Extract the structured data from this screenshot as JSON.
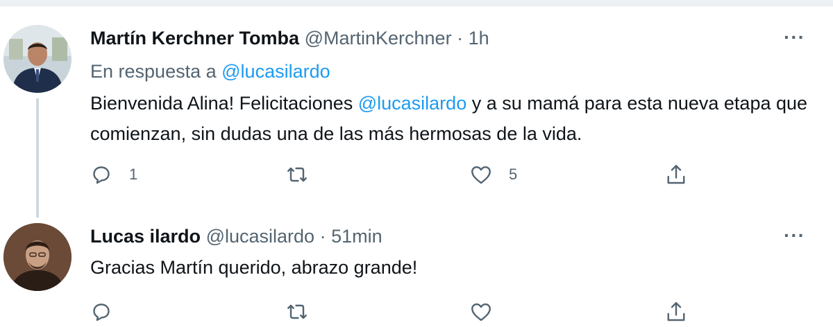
{
  "tweets": [
    {
      "name": "Martín Kerchner Tomba",
      "handle": "@MartinKerchner",
      "separator": "·",
      "time": "1h",
      "reply_prefix": "En respuesta a",
      "reply_handle": "@lucasilardo",
      "text_part1": "Bienvenida Alina! Felicitaciones ",
      "text_mention": "@lucasilardo",
      "text_part2": " y a su mamá para esta nueva etapa que comienzan, sin dudas una de las más hermosas de la vida.",
      "reply_count": "1",
      "retweet_count": "",
      "like_count": "5",
      "more": "···"
    },
    {
      "name": "Lucas ilardo",
      "handle": "@lucasilardo",
      "separator": "·",
      "time": "51min",
      "text": "Gracias Martín querido, abrazo grande!",
      "more": "···"
    }
  ],
  "colors": {
    "accent": "#1d9bf0",
    "secondary_text": "#536471",
    "thread_line": "#cfd9de"
  },
  "icons": [
    "reply-icon",
    "retweet-icon",
    "like-icon",
    "share-icon",
    "more-icon"
  ]
}
